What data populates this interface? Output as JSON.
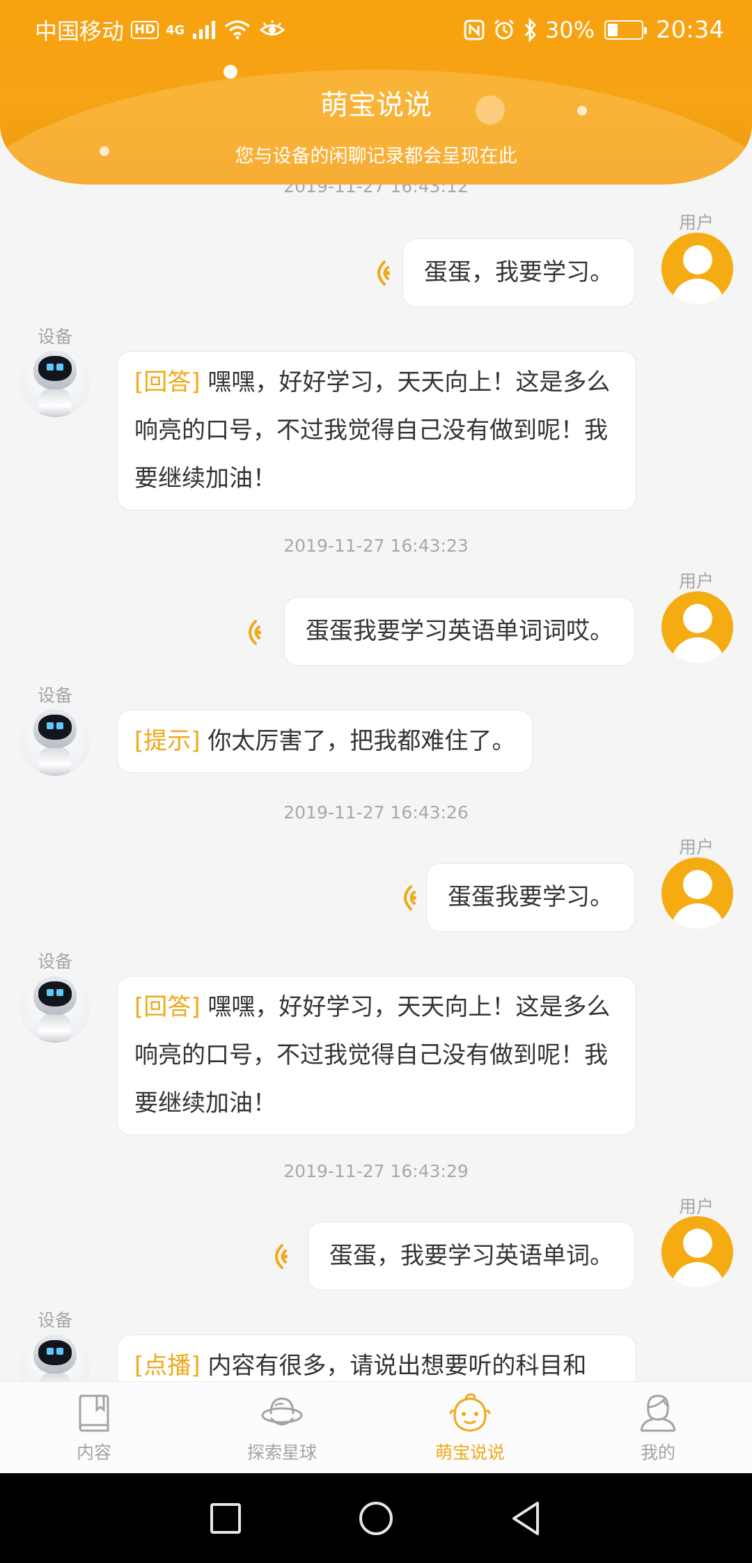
{
  "status_bar": {
    "carrier": "中国移动",
    "hd": "HD",
    "network": "4G",
    "battery_percent": "30%",
    "battery_level": 0.3,
    "time": "20:34"
  },
  "header": {
    "title": "萌宝说说",
    "subtitle": "您与设备的闲聊记录都会呈现在此"
  },
  "chat": {
    "user_label": "用户",
    "device_label": "设备",
    "messages": [
      {
        "timestamp": "2019-11-27 16:43:12",
        "user": "蛋蛋，我要学习。",
        "device_tag": "[回答]",
        "device": "嘿嘿，好好学习，天天向上！这是多么响亮的口号，不过我觉得自己没有做到呢！我要继续加油！"
      },
      {
        "timestamp": "2019-11-27 16:43:23",
        "user": "蛋蛋我要学习英语单词词哎。",
        "device_tag": "[提示]",
        "device": "你太厉害了，把我都难住了。"
      },
      {
        "timestamp": "2019-11-27 16:43:26",
        "user": "蛋蛋我要学习。",
        "device_tag": "[回答]",
        "device": "嘿嘿，好好学习，天天向上！这是多么响亮的口号，不过我觉得自己没有做到呢！我要继续加油！"
      },
      {
        "timestamp": "2019-11-27 16:43:29",
        "user": "蛋蛋，我要学习英语单词。",
        "device_tag": "[点播]",
        "device": "内容有很多，请说出想要听的科目和"
      }
    ]
  },
  "bottom_nav": {
    "items": [
      {
        "label": "内容",
        "icon": "book-icon"
      },
      {
        "label": "探索星球",
        "icon": "planet-icon"
      },
      {
        "label": "萌宝说说",
        "icon": "baby-face-icon"
      },
      {
        "label": "我的",
        "icon": "profile-icon"
      }
    ],
    "active_index": 2,
    "active_color": "#f0a818",
    "inactive_color": "#a3a3a3"
  },
  "system_nav": {
    "buttons": [
      "recent-apps-icon",
      "home-icon",
      "back-icon"
    ]
  },
  "colors": {
    "brand": "#f7a10f",
    "tag": "#f0a818",
    "user_avatar": "#f5ab12"
  }
}
